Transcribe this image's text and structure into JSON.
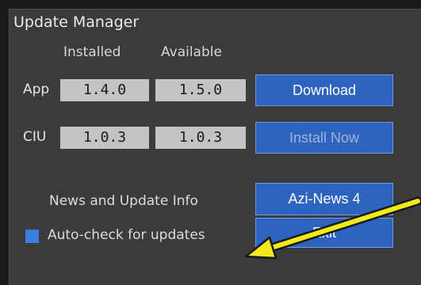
{
  "window": {
    "title": "Update Manager"
  },
  "columns": {
    "installed": "Installed",
    "available": "Available"
  },
  "rows": [
    {
      "label": "App",
      "installed": "1.4.0",
      "available": "1.5.0",
      "action": "Download",
      "action_enabled": true
    },
    {
      "label": "CIU",
      "installed": "1.0.3",
      "available": "1.0.3",
      "action": "Install Now",
      "action_enabled": false
    }
  ],
  "news": {
    "label": "News and Update Info",
    "button": "Azi-News 4"
  },
  "auto_check": {
    "label": "Auto-check for updates",
    "checked": true
  },
  "exit_button": "Exit",
  "colors": {
    "panel_bg": "#3b3b3b",
    "button_bg": "#2f63c0",
    "button_border": "#6f99e4",
    "version_box_bg": "#c3c3c3",
    "checkbox": "#3a7fe0",
    "annotation_arrow": "#f2ea1e"
  },
  "annotation": {
    "icon": "yellow-arrow-pointing-to-auto-check"
  }
}
